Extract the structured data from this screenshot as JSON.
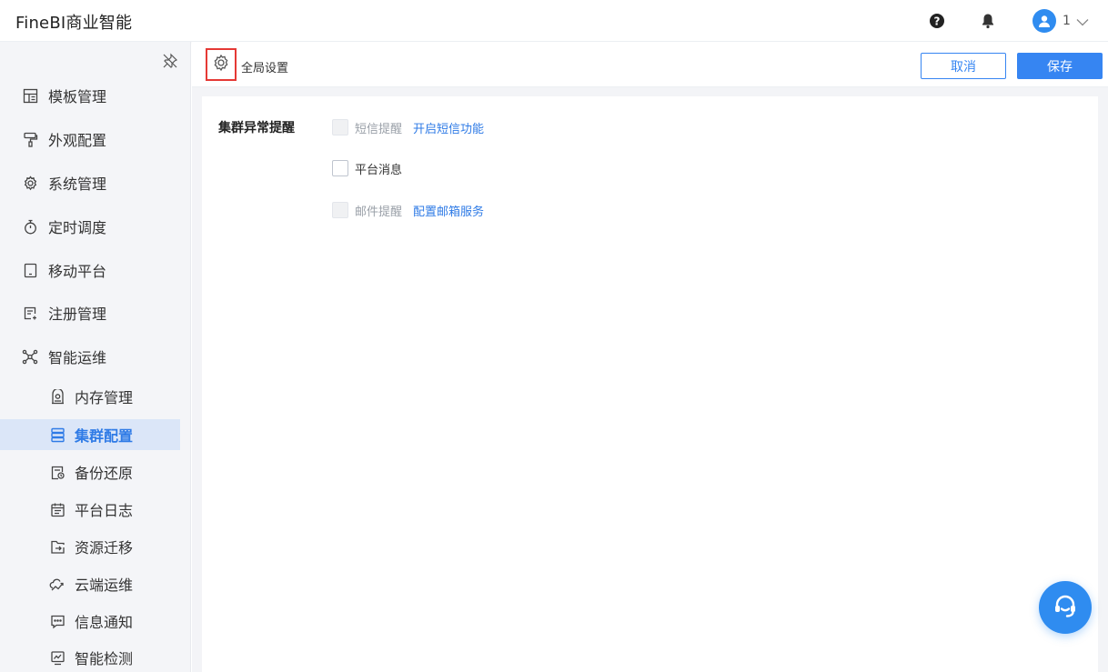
{
  "header": {
    "app_title": "FineBI商业智能",
    "user_name": "1",
    "icons": [
      "help-icon",
      "bell-icon",
      "user-avatar-icon",
      "chevron-down-icon"
    ]
  },
  "sidebar": {
    "items": [
      {
        "label": "模板管理",
        "icon": "template-icon"
      },
      {
        "label": "外观配置",
        "icon": "paint-roller-icon"
      },
      {
        "label": "系统管理",
        "icon": "gear-icon"
      },
      {
        "label": "定时调度",
        "icon": "stopwatch-icon"
      },
      {
        "label": "移动平台",
        "icon": "tablet-icon"
      },
      {
        "label": "注册管理",
        "icon": "register-icon"
      },
      {
        "label": "智能运维",
        "icon": "network-icon"
      }
    ],
    "sub_items": [
      {
        "label": "内存管理",
        "icon": "memory-icon"
      },
      {
        "label": "集群配置",
        "icon": "cluster-icon",
        "active": true
      },
      {
        "label": "备份还原",
        "icon": "backup-icon"
      },
      {
        "label": "平台日志",
        "icon": "calendar-log-icon"
      },
      {
        "label": "资源迁移",
        "icon": "migrate-icon"
      },
      {
        "label": "云端运维",
        "icon": "cloud-ops-icon"
      },
      {
        "label": "信息通知",
        "icon": "message-icon"
      },
      {
        "label": "智能检测",
        "icon": "monitor-icon"
      }
    ]
  },
  "toolbar": {
    "title": "全局设置",
    "cancel_label": "取消",
    "save_label": "保存"
  },
  "settings": {
    "section_label": "集群异常提醒",
    "options": [
      {
        "label": "短信提醒",
        "checked": false,
        "disabled": true,
        "link": "开启短信功能"
      },
      {
        "label": "平台消息",
        "checked": false,
        "disabled": false
      },
      {
        "label": "邮件提醒",
        "checked": false,
        "disabled": true,
        "link": "配置邮箱服务"
      }
    ]
  },
  "colors": {
    "accent": "#3685f2",
    "highlight_border": "#e53935",
    "active_bg": "#dbe6f8",
    "sidebar_bg": "#f4f5f8"
  }
}
